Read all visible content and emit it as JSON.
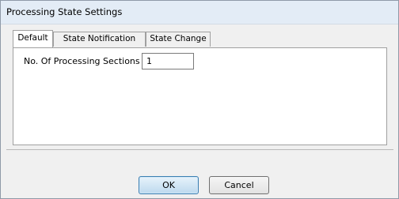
{
  "window": {
    "title": "Processing State Settings"
  },
  "tabs": [
    {
      "label": "Default",
      "selected": true
    },
    {
      "label": "State Notification",
      "selected": false
    },
    {
      "label": "State Change",
      "selected": false
    }
  ],
  "default_tab": {
    "sections_label": "No. Of Processing Sections",
    "sections_value": "1"
  },
  "buttons": {
    "ok_label": "OK",
    "cancel_label": "Cancel"
  },
  "colors": {
    "titlebar": "#e3ecf6",
    "window_bg": "#f0f0f0",
    "default_button_border": "#3c7fb1"
  }
}
